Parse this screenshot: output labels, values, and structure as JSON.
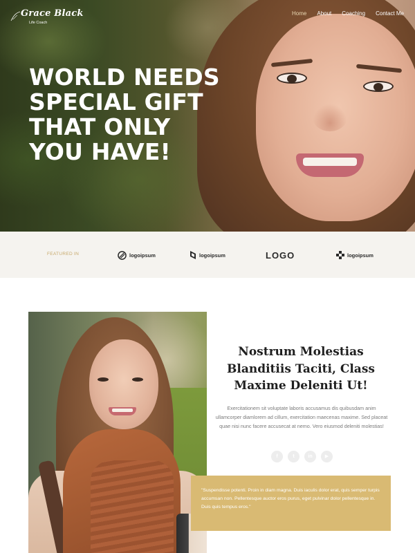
{
  "header": {
    "logo_signature": "Signature",
    "logo_name": "Grace Black",
    "logo_subtitle": "Life Coach",
    "nav": [
      {
        "label": "Home",
        "active": true
      },
      {
        "label": "About",
        "active": false
      },
      {
        "label": "Coaching",
        "active": false
      },
      {
        "label": "Contact Me",
        "active": false
      }
    ]
  },
  "hero": {
    "title_lines": [
      "WORLD NEEDS",
      "SPECIAL GIFT",
      "THAT ONLY",
      "YOU HAVE!"
    ]
  },
  "featured": {
    "label": "FEATURED IN",
    "brands": [
      "logoipsum",
      "logoipsum",
      "LOGO",
      "logoipsum"
    ]
  },
  "content": {
    "heading": "Nostrum Molestias Blanditiis Taciti, Class Maxime Deleniti Ut!",
    "body": "Exercitationem sit voluptate laboris accusamus dis quibusdam anim ullamcorper diamlorem ad cillum, exercitation maecenas maxime. Sed placeat quae nisi nunc facere accusecat at nemo. Vero eiusmod deleniti molestias!",
    "socials": [
      {
        "icon": "facebook-icon",
        "glyph": "f"
      },
      {
        "icon": "twitter-icon",
        "glyph": "t"
      },
      {
        "icon": "linkedin-icon",
        "glyph": "in"
      },
      {
        "icon": "youtube-icon",
        "glyph": "▶"
      }
    ],
    "quote": "\"Suspendisse potenti. Proin in diam magna. Duis iaculis dolor erat, quis semper turpis accumsan non. Pellentesque auctor eros purus, eget pulvinar dolor pellentesque in. Duis quis tempus eros.\""
  },
  "colors": {
    "accent": "#d9ba73",
    "featured_bg": "#f5f3ef",
    "nav_active": "#e8d7b2"
  }
}
